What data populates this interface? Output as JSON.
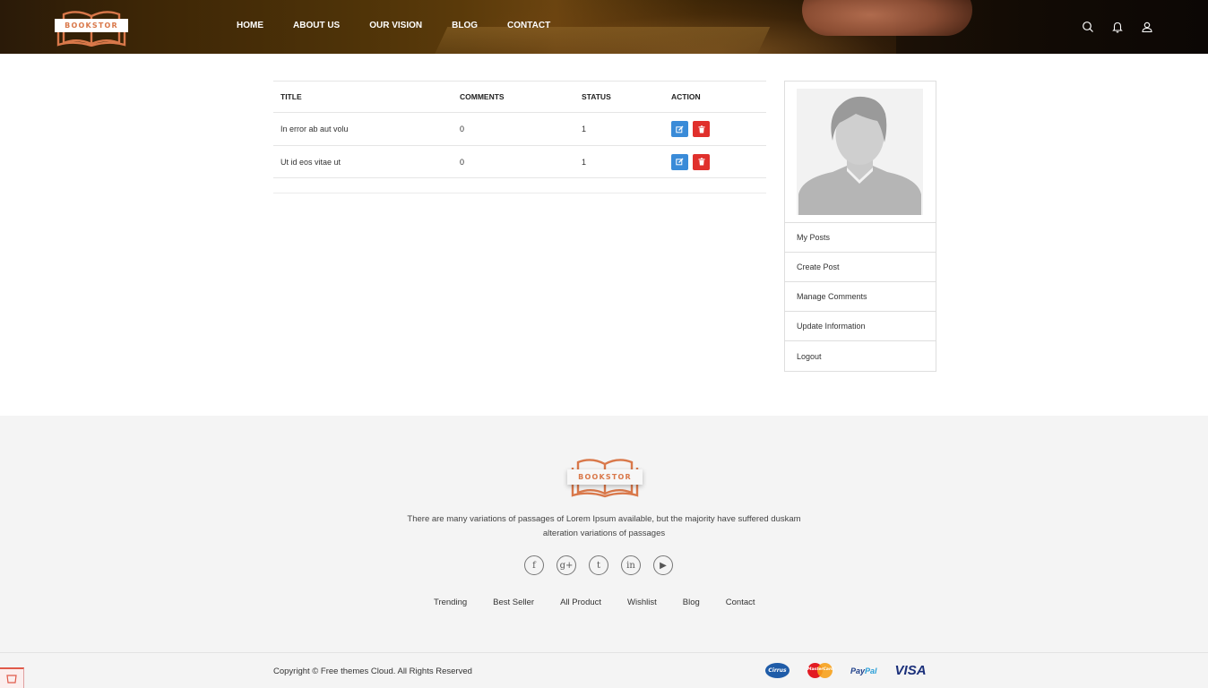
{
  "brand": {
    "name": "BOOKSTOR",
    "accent": "#d9784a"
  },
  "nav": [
    "HOME",
    "ABOUT US",
    "OUR VISION",
    "BLOG",
    "CONTACT"
  ],
  "header_icons": [
    "search-icon",
    "bell-icon",
    "user-icon"
  ],
  "table": {
    "headers": [
      "TITLE",
      "COMMENTS",
      "STATUS",
      "ACTION"
    ],
    "rows": [
      {
        "title": "In error ab aut volu",
        "comments": "0",
        "status": "1"
      },
      {
        "title": "Ut id eos vitae ut",
        "comments": "0",
        "status": "1"
      }
    ],
    "edit_color": "#3a8bd8",
    "delete_color": "#e0302c"
  },
  "sidebar": {
    "items": [
      "My Posts",
      "Create Post",
      "Manage Comments",
      "Update Information",
      "Logout"
    ]
  },
  "footer": {
    "description": "There are many variations of passages of Lorem Ipsum available, but the majority have suffered duskam alteration variations of passages",
    "social_icons": [
      "facebook-icon",
      "google-plus-icon",
      "tumblr-icon",
      "linkedin-icon",
      "youtube-icon"
    ],
    "social_glyphs": [
      "f",
      "g+",
      "t",
      "in",
      "▶"
    ],
    "links": [
      "Trending",
      "Best Seller",
      "All Product",
      "Wishlist",
      "Blog",
      "Contact"
    ],
    "copyright": "Copyright © Free themes Cloud. All Rights Reserved",
    "payments": {
      "cirrus": "Cirrus",
      "mastercard": "MasterCard",
      "paypal_1": "Pay",
      "paypal_2": "Pal",
      "visa": "VISA"
    }
  }
}
